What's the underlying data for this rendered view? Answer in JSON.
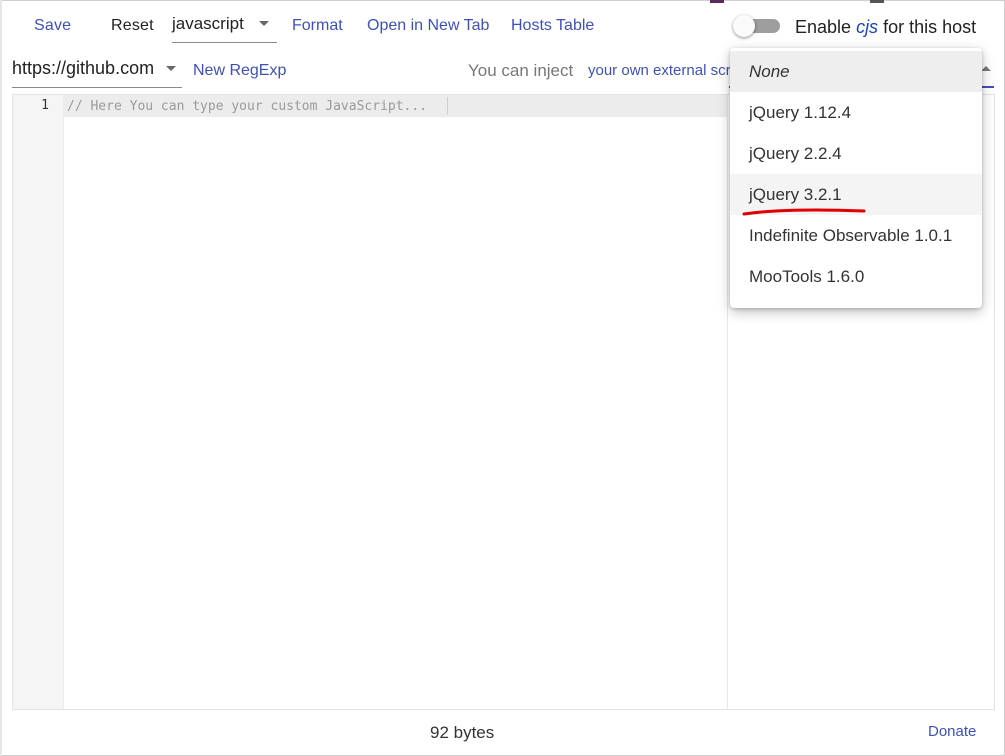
{
  "toolbar": {
    "save_label": "Save",
    "reset_label": "Reset",
    "language_value": "javascript",
    "format_label": "Format",
    "open_new_tab_label": "Open in New Tab",
    "hosts_table_label": "Hosts Table",
    "enable_prefix": "Enable ",
    "enable_cjs": "cjs",
    "enable_suffix": " for this host",
    "toggle_on": false
  },
  "row2": {
    "host_value": "https://github.com",
    "new_regexp_label": "New RegExp",
    "inject_text": "You can inject",
    "inject_link": "your own external scripts"
  },
  "editor": {
    "line_number": "1",
    "placeholder": "// Here You can type your custom JavaScript..."
  },
  "footer": {
    "bytes": "92 bytes",
    "donate_label": "Donate"
  },
  "dropdown": {
    "items": [
      {
        "label": "None"
      },
      {
        "label": "jQuery 1.12.4"
      },
      {
        "label": "jQuery 2.2.4"
      },
      {
        "label": "jQuery 3.2.1"
      },
      {
        "label": "Indefinite Observable 1.0.1"
      },
      {
        "label": "MooTools 1.6.0"
      }
    ],
    "selected": "None",
    "highlighted": "jQuery 3.2.1"
  },
  "colors": {
    "accent": "#3f51b5",
    "annotation": "#e00000",
    "cjs": "#1a3fbf"
  }
}
